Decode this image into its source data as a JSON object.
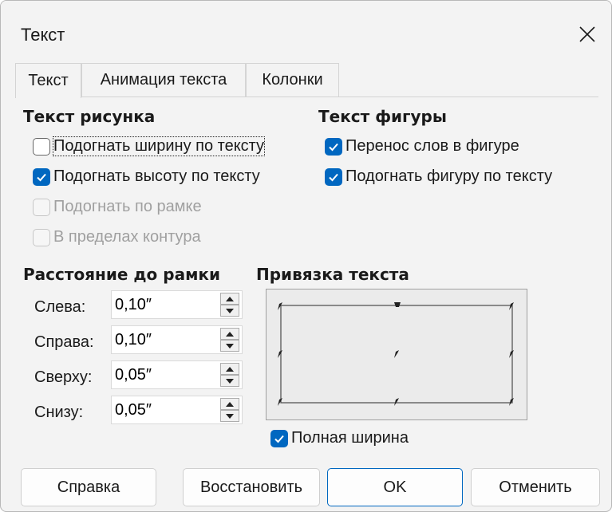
{
  "window": {
    "title": "Текст"
  },
  "tabs": [
    {
      "label": "Текст",
      "active": true
    },
    {
      "label": "Анимация текста",
      "active": false
    },
    {
      "label": "Колонки",
      "active": false
    }
  ],
  "picture_text": {
    "heading": "Текст рисунка",
    "options": [
      {
        "label": "Подогнать ширину по тексту",
        "checked": false,
        "enabled": true
      },
      {
        "label": "Подогнать высоту по тексту",
        "checked": true,
        "enabled": true
      },
      {
        "label": "Подогнать по рамке",
        "checked": false,
        "enabled": false
      },
      {
        "label": "В пределах контура",
        "checked": false,
        "enabled": false
      }
    ]
  },
  "shape_text": {
    "heading": "Текст фигуры",
    "options": [
      {
        "label": "Перенос слов в фигуре",
        "checked": true,
        "enabled": true
      },
      {
        "label": "Подогнать фигуру по тексту",
        "checked": true,
        "enabled": true
      }
    ]
  },
  "margins": {
    "heading": "Расстояние до рамки",
    "fields": [
      {
        "label": "Слева:",
        "value": "0,10″"
      },
      {
        "label": "Справа:",
        "value": "0,10″"
      },
      {
        "label": "Сверху:",
        "value": "0,05″"
      },
      {
        "label": "Снизу:",
        "value": "0,05″"
      }
    ]
  },
  "anchor": {
    "heading": "Привязка текста",
    "full_width_label": "Полная ширина",
    "full_width_checked": true
  },
  "buttons": {
    "help": "Справка",
    "restore": "Восстановить",
    "ok": "OK",
    "cancel": "Отменить"
  },
  "colors": {
    "accent": "#0067c0",
    "background": "#f3f3f3"
  }
}
